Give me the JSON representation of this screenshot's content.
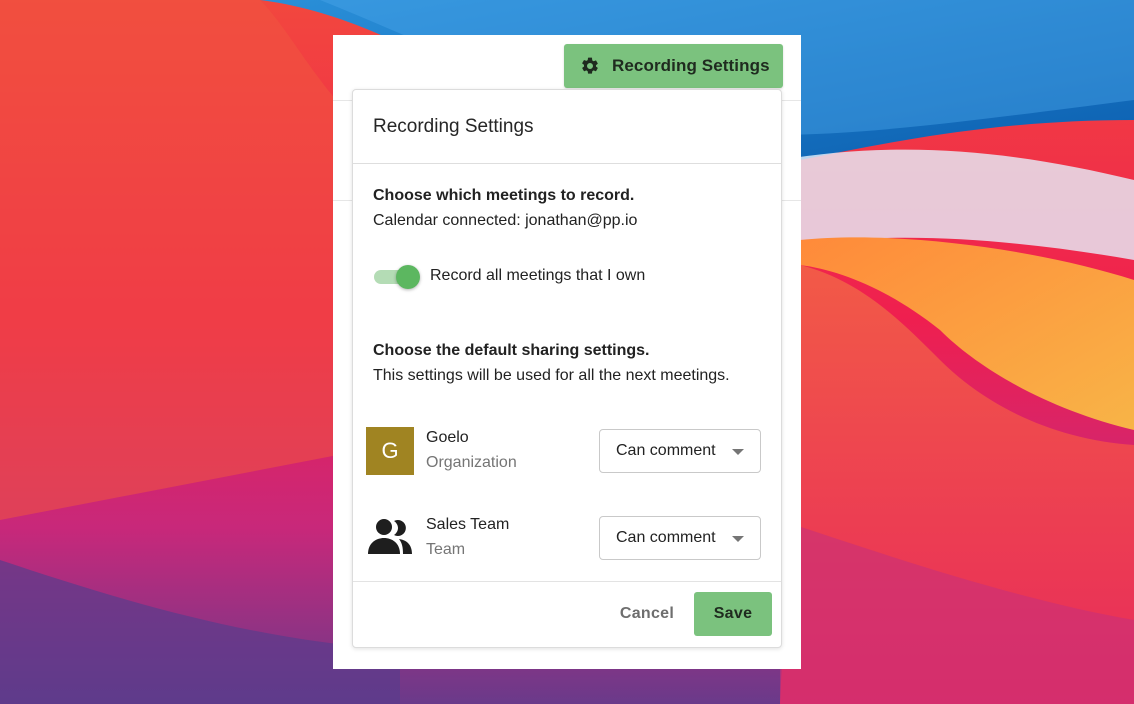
{
  "toolbar": {
    "recording_settings_button": {
      "label": "Recording Settings",
      "icon": "gear-icon"
    }
  },
  "dialog": {
    "title": "Recording Settings",
    "meetings_section": {
      "heading": "Choose which meetings to record.",
      "calendar_text": "Calendar connected: jonathan@pp.io",
      "toggle": {
        "label": "Record all meetings that I own",
        "on": true
      }
    },
    "sharing_section": {
      "heading": "Choose the default sharing settings.",
      "description": "This settings will be used for all the next meetings.",
      "entities": [
        {
          "name": "Goelo",
          "type": "Organization",
          "avatar_letter": "G",
          "avatar_color": "#a08422",
          "permission": "Can comment"
        },
        {
          "name": "Sales Team",
          "type": "Team",
          "icon": "people-icon",
          "permission": "Can comment"
        }
      ]
    },
    "footer": {
      "cancel_label": "Cancel",
      "save_label": "Save"
    }
  },
  "colors": {
    "accent_green": "#7bc27e",
    "toggle_green": "#5cb760"
  }
}
